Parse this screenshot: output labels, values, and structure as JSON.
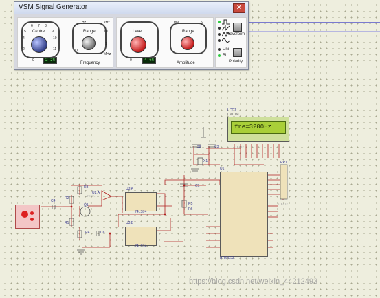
{
  "window": {
    "title": "VSM Signal Generator",
    "close_icon": "close-icon",
    "frequency": {
      "centre_label": "Centre",
      "range_label": "Range",
      "section_label": "Frequency",
      "centre_readout": "2.20",
      "range_units": [
        "Hz",
        "kHz",
        "MHz"
      ],
      "range_scale": [
        "0.1",
        "1",
        "10"
      ]
    },
    "amplitude": {
      "level_label": "Level",
      "range_label": "Range",
      "section_label": "Amplitude",
      "level_readout": "4.60",
      "range_units": [
        "mV",
        "V"
      ],
      "range_scale": [
        "1",
        "10"
      ]
    },
    "waveform_label": "Waveform",
    "polarity_label": "Polarity",
    "uni_label": "Uni",
    "bi_label": "Bi",
    "waveforms": [
      "square-wave-icon",
      "sawtooth-wave-icon",
      "triangle-wave-icon",
      "sine-wave-icon"
    ],
    "dial_numbers": [
      "0",
      "1",
      "2",
      "3",
      "4",
      "5",
      "6",
      "7",
      "8",
      "9",
      "10",
      "11",
      "12"
    ]
  },
  "schematic": {
    "lcd": {
      "ref": "LCD1",
      "part": "LM016L",
      "display": "fre=3200Hz"
    },
    "u1": {
      "ref": "U1",
      "part": "AT89C52"
    },
    "u3a": {
      "ref": "U3:A",
      "part": "74LS74"
    },
    "u3b": {
      "ref": "U3:B",
      "part": "74LS74"
    },
    "q1": {
      "ref": "Q1",
      "part": "2N3904"
    },
    "rp1": {
      "ref": "RP1",
      "part": "RESPACK-8"
    },
    "resistors": [
      "R1",
      "R2",
      "R3",
      "R4",
      "R5",
      "R6"
    ],
    "capacitors": [
      "C1",
      "C2",
      "C3",
      "C4",
      "C6"
    ],
    "crystal": "X1",
    "op_amp": "U2:A",
    "hint_text": "<TEXT>"
  },
  "watermark": "https://blog.csdn.net/weixin_44212493",
  "colors": {
    "canvas": "#eeeede",
    "wire": "#b02020",
    "ic_body": "#efe2ba",
    "lcd_screen": "#a9cf38"
  }
}
